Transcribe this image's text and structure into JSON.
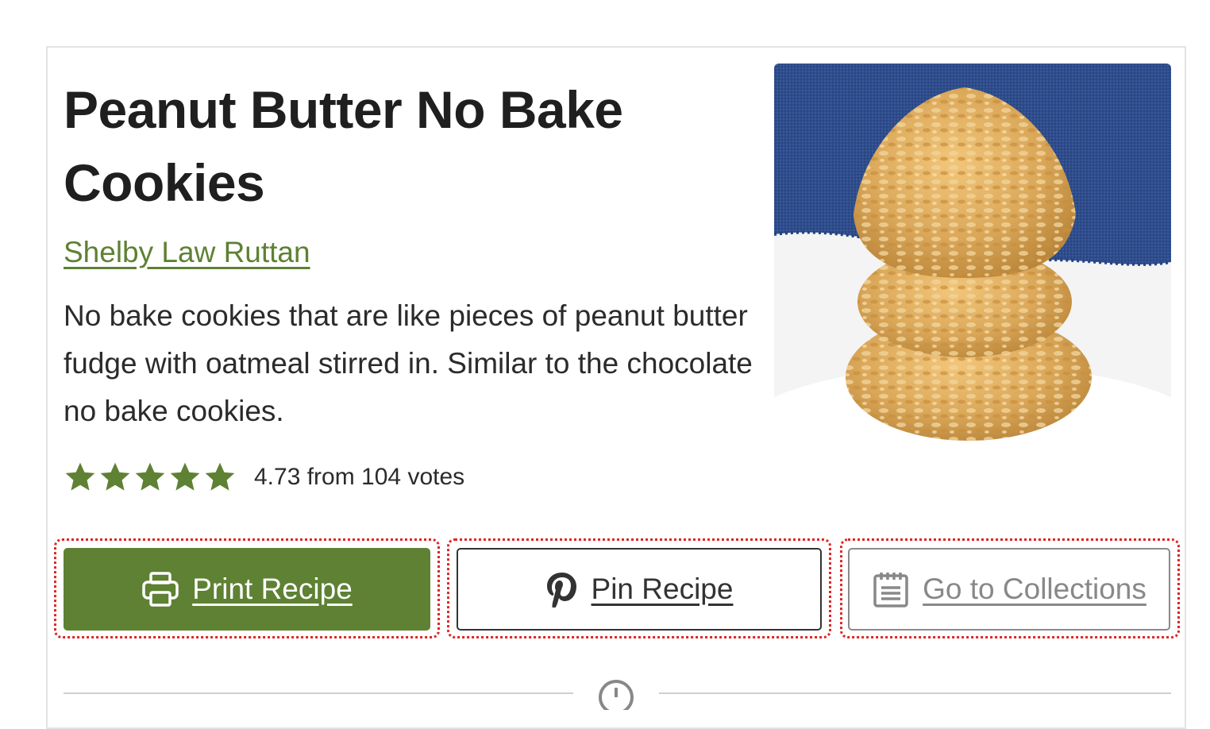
{
  "recipe": {
    "title": "Peanut Butter No Bake Cookies",
    "author": "Shelby Law Ruttan",
    "summary": "No bake cookies that are like pieces of peanut butter fudge with oatmeal stirred in. Similar to the chocolate no bake cookies.",
    "rating": {
      "value": 4.73,
      "stars_filled": 5,
      "text": "4.73 from 104 votes"
    },
    "image": {
      "icon": "cookie-stack-photo"
    }
  },
  "buttons": {
    "print": {
      "label": "Print Recipe",
      "icon": "printer-icon"
    },
    "pin": {
      "label": "Pin Recipe",
      "icon": "pinterest-icon"
    },
    "collections": {
      "label": "Go to Collections",
      "icon": "calendar-list-icon"
    }
  },
  "colors": {
    "accent": "#5e8133",
    "focus_outline": "#e02424",
    "text": "#222222"
  },
  "divider": {
    "icon": "timer-icon"
  }
}
